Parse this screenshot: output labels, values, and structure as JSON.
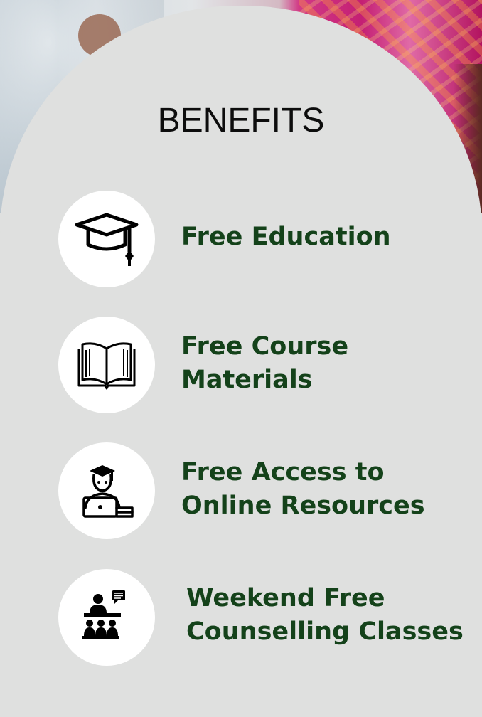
{
  "title": "BENEFITS",
  "benefits": [
    {
      "icon": "graduation-cap-icon",
      "lines": [
        "Free Education"
      ]
    },
    {
      "icon": "open-book-icon",
      "lines": [
        "Free Course",
        "Materials"
      ]
    },
    {
      "icon": "student-laptop-icon",
      "lines": [
        "Free Access to",
        "Online Resources"
      ]
    },
    {
      "icon": "counselling-class-icon",
      "lines": [
        "Weekend Free",
        "Counselling Classes"
      ]
    }
  ],
  "colors": {
    "label_green": "#14421a",
    "panel_gray": "#dfe0df",
    "circle_white": "#ffffff"
  }
}
